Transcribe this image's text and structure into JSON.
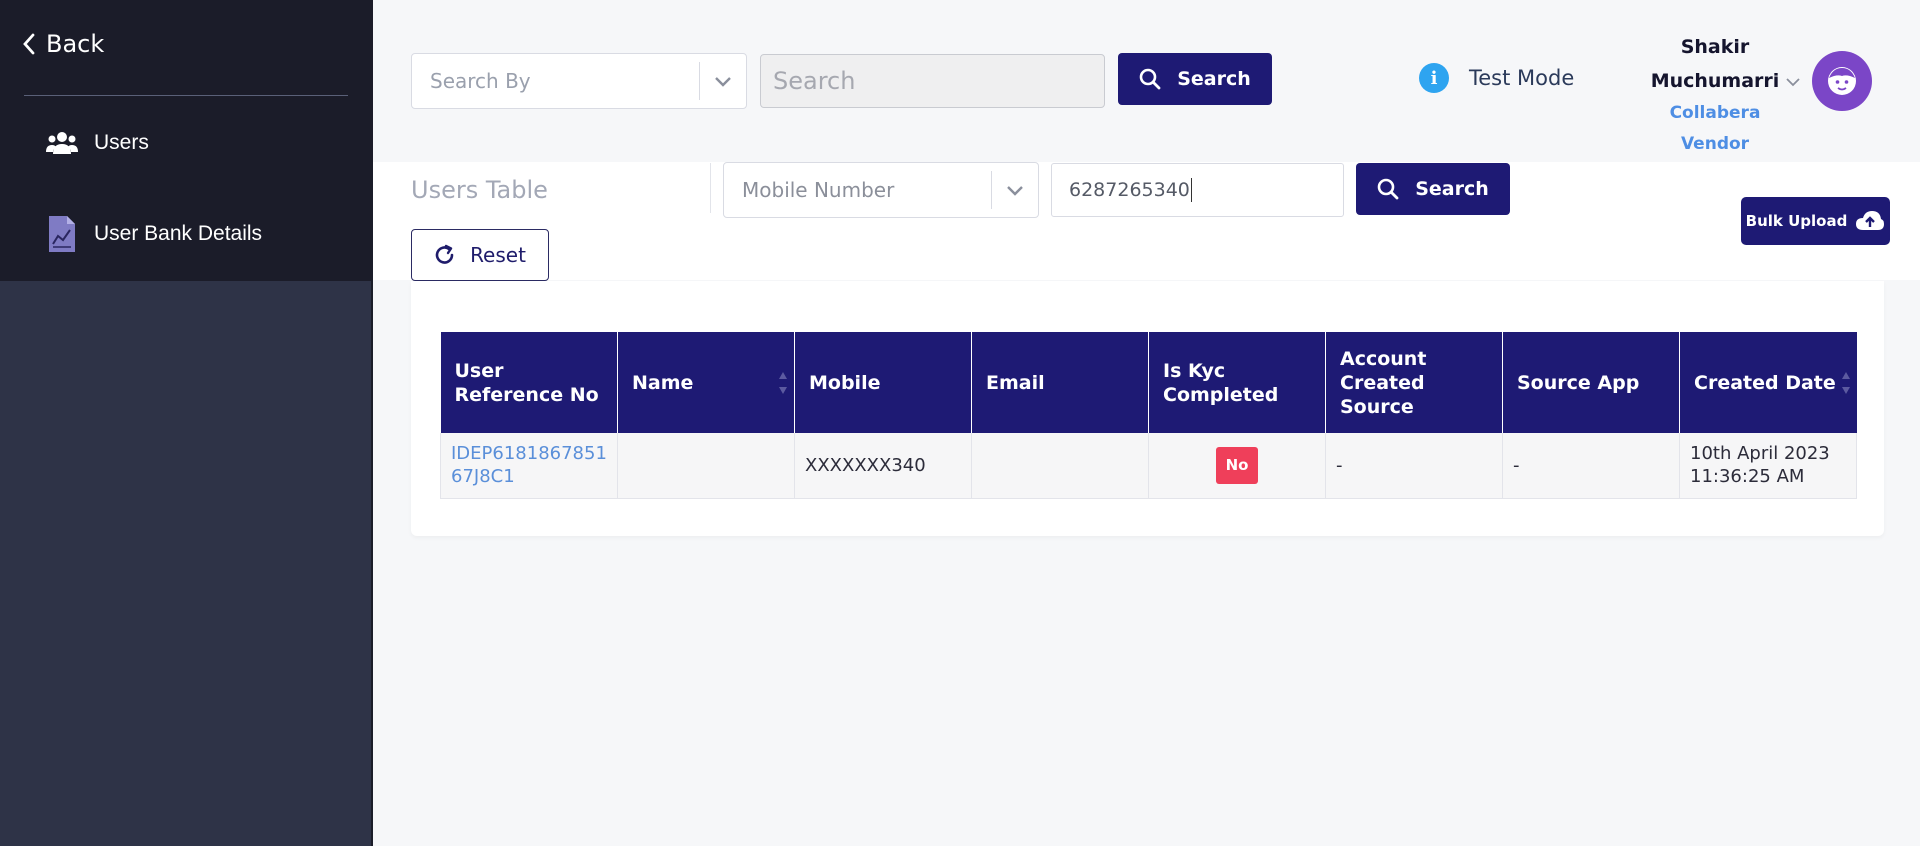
{
  "sidebar": {
    "back_label": "Back",
    "items": [
      {
        "label": "Users",
        "icon": "users-icon"
      },
      {
        "label": "User Bank Details",
        "icon": "document-chart-icon"
      }
    ]
  },
  "header": {
    "search_by_placeholder": "Search By",
    "search_placeholder": "Search",
    "search_button": "Search",
    "test_mode_label": "Test Mode",
    "user": {
      "name_line1": "Shakir",
      "name_line2": "Muchumarri",
      "company": "Collabera",
      "role": "Vendor"
    }
  },
  "toolbar": {
    "title": "Users Table",
    "filter_field": "Mobile Number",
    "filter_value": "6287265340",
    "search_button": "Search",
    "reset_button": "Reset",
    "bulk_upload_button": "Bulk Upload"
  },
  "table": {
    "columns": [
      "User Reference No",
      "Name",
      "Mobile",
      "Email",
      "Is Kyc Completed",
      "Account Created Source",
      "Source App",
      "Created Date"
    ],
    "rows": [
      {
        "ref": "IDEP618186785167J8C1",
        "name": "",
        "mobile": "XXXXXXX340",
        "email": "",
        "kyc": "No",
        "account_source": "-",
        "source_app": "-",
        "created_date_line1": "10th April 2023",
        "created_date_line2": "11:36:25 AM"
      }
    ]
  },
  "colors": {
    "primary": "#1e1a74",
    "sidebar_top": "#1b1c29",
    "sidebar_bottom": "#2e3347",
    "link": "#5a8fd9",
    "danger": "#ef3f5a",
    "avatar": "#7b46c7",
    "info": "#2ea4f0"
  }
}
